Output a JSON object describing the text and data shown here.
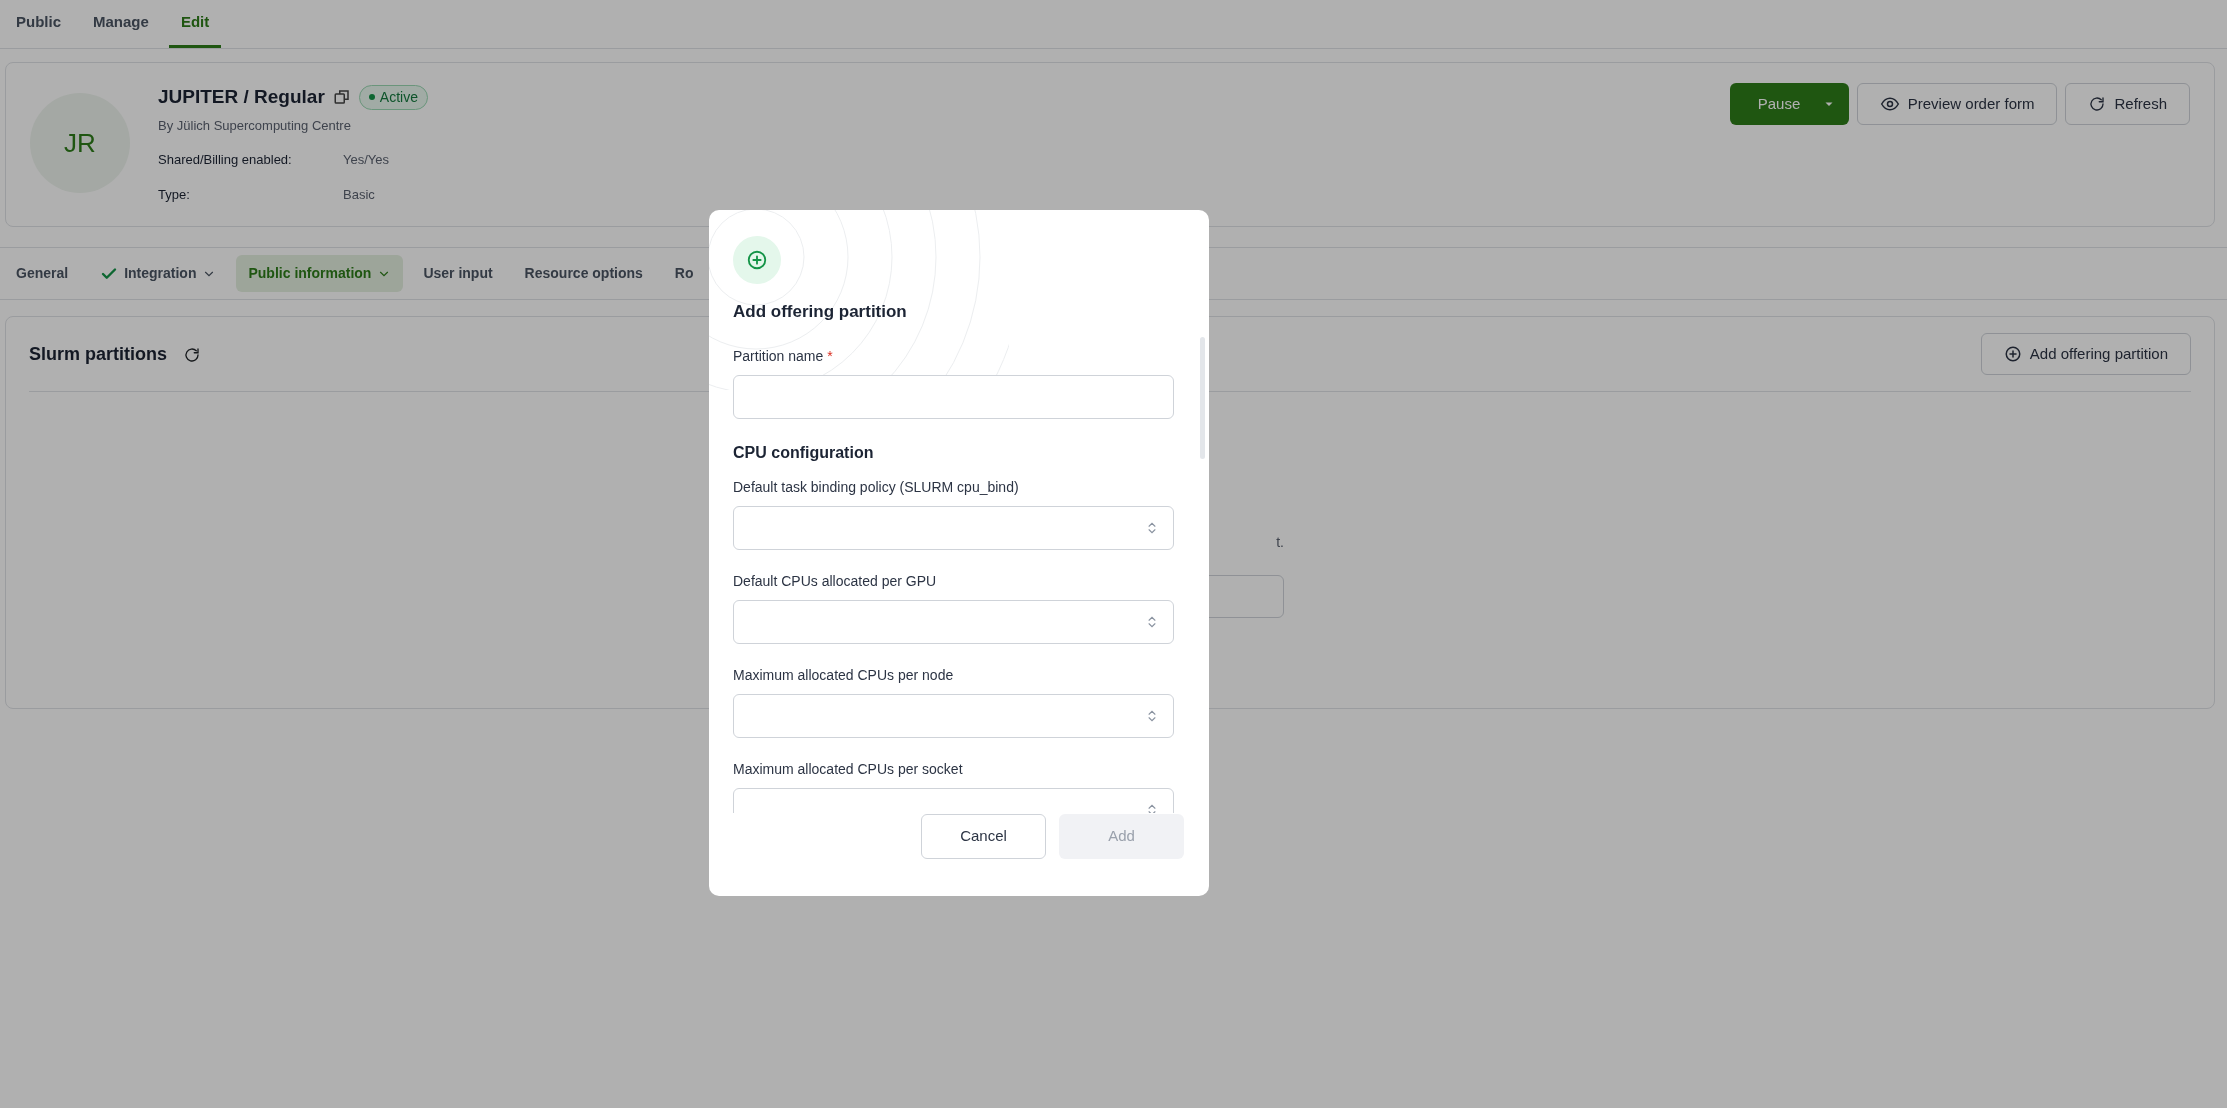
{
  "top_tabs": [
    {
      "label": "Public",
      "selected": false
    },
    {
      "label": "Manage",
      "selected": false
    },
    {
      "label": "Edit",
      "selected": true
    }
  ],
  "offering": {
    "avatar": "JR",
    "title": "JUPITER / Regular",
    "status": "Active",
    "provider": "By Jülich Supercomputing Centre",
    "fields": [
      {
        "label": "Shared/Billing enabled:",
        "value": "Yes/Yes"
      },
      {
        "label": "Type:",
        "value": "Basic"
      }
    ]
  },
  "actions": {
    "primary": "Pause",
    "buttons": [
      {
        "kind": "preview",
        "label": "Preview order form"
      },
      {
        "kind": "refresh",
        "label": "Refresh"
      }
    ]
  },
  "section_tabs": [
    {
      "label": "General",
      "selected": false,
      "complete": false,
      "dropdown": false
    },
    {
      "label": "Integration",
      "selected": false,
      "complete": true,
      "dropdown": true
    },
    {
      "label": "Public information",
      "selected": true,
      "complete": false,
      "dropdown": true
    },
    {
      "label": "User input",
      "selected": false,
      "complete": false,
      "dropdown": false
    },
    {
      "label": "Resource options",
      "selected": false,
      "complete": false,
      "dropdown": false
    },
    {
      "label": "Ro",
      "selected": false,
      "complete": false,
      "dropdown": false
    }
  ],
  "partitions": {
    "title": "Slurm partitions",
    "add_button": "Add offering partition",
    "empty_text": "t."
  },
  "dialog": {
    "title": "Add offering partition",
    "fields": [
      {
        "kind": "text",
        "label": "Partition name",
        "required": true
      },
      {
        "kind": "heading",
        "label": "CPU configuration"
      },
      {
        "kind": "number",
        "label": "Default task binding policy (SLURM cpu_bind)",
        "required": false
      },
      {
        "kind": "number",
        "label": "Default CPUs allocated per GPU",
        "required": false
      },
      {
        "kind": "number",
        "label": "Maximum allocated CPUs per node",
        "required": false
      },
      {
        "kind": "number",
        "label": "Maximum allocated CPUs per socket",
        "required": false
      }
    ],
    "required_mark": "*",
    "cancel": "Cancel",
    "submit": {
      "label": "Add",
      "disabled": true
    }
  }
}
